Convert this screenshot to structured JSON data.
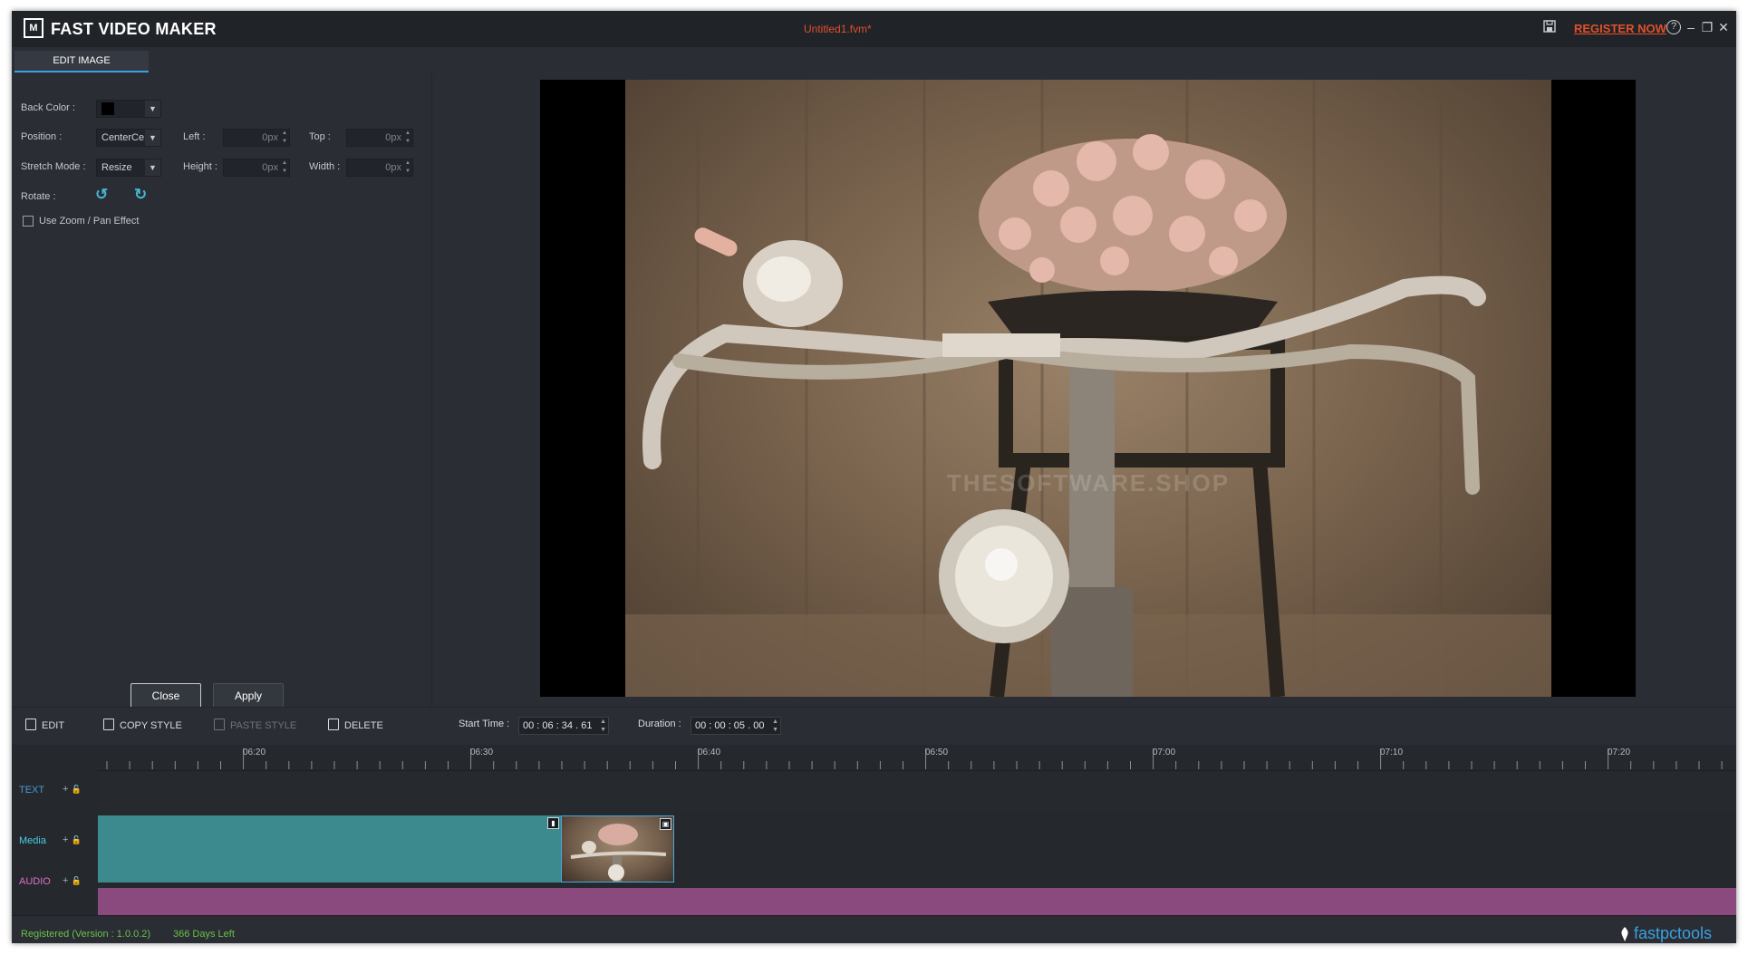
{
  "app": {
    "logo_text": "M",
    "title": "FAST VIDEO MAKER",
    "file": "Untitled1.fvm*",
    "register": "REGISTER NOW",
    "help": "?",
    "minimize": "–",
    "maximize": "❐",
    "close": "✕"
  },
  "edit_panel": {
    "tab": "EDIT IMAGE",
    "back_color_label": "Back Color :",
    "back_color_value": "#000000",
    "position_label": "Position :",
    "position_value": "CenterCe",
    "left_label": "Left :",
    "left_value": "0px",
    "top_label": "Top :",
    "top_value": "0px",
    "stretch_label": "Stretch Mode :",
    "stretch_value": "Resize",
    "height_label": "Height :",
    "height_value": "0px",
    "width_label": "Width :",
    "width_value": "0px",
    "rotate_label": "Rotate :",
    "zoom_label": "Use Zoom / Pan Effect",
    "close_btn": "Close",
    "apply_btn": "Apply"
  },
  "preview": {
    "watermark": "THESOFTWARE.SHOP"
  },
  "toolbar": {
    "edit": "EDIT",
    "copy_style": "COPY STYLE",
    "paste_style": "PASTE STYLE",
    "delete": "DELETE",
    "start_time_label": "Start Time :",
    "start_time_value": "00 : 06 : 34 . 61",
    "duration_label": "Duration :",
    "duration_value": "00 : 00 : 05 . 00"
  },
  "timeline": {
    "ticks": [
      "06:20",
      "06:30",
      "06:40",
      "06:50",
      "07:00",
      "07:10",
      "07:20"
    ],
    "tracks": {
      "text": "TEXT",
      "media": "Media",
      "audio": "AUDIO"
    },
    "add_icon": "+",
    "lock_icon": "🔓",
    "colors": {
      "text_track": "#4a9ad0",
      "media_track": "#4ad0e0",
      "audio_track": "#e070c8",
      "media_clip": "#3d8a8e",
      "audio_clip": "#8a4a7e"
    }
  },
  "status": {
    "registered": "Registered (Version : 1.0.0.2)",
    "days_left": "366 Days Left",
    "brand": "fastpctools"
  }
}
